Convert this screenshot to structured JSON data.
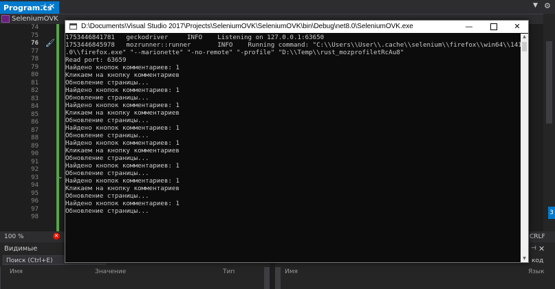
{
  "vs": {
    "doc_tab": "Program.cs",
    "doc_tab_pin": "⊣",
    "doc_tab_close": "✕",
    "nav_combo": "SeleniumOVK",
    "line_numbers": [
      "74",
      "75",
      "76",
      "77",
      "78",
      "79",
      "80",
      "81",
      "82",
      "83",
      "84",
      "85",
      "86",
      "87",
      "88",
      "89",
      "90",
      "91",
      "92",
      "93",
      "94",
      "95",
      "96",
      "97",
      "98"
    ],
    "current_line": "76",
    "zoom": "100 %",
    "error_glyph": "✕",
    "line_ending": "CRLF",
    "right_marker": "3",
    "locals_panel": {
      "title": "Видимые",
      "search_placeholder": "Поиск (Ctrl+E)",
      "col_name": "Имя",
      "col_value": "Значение",
      "col_type": "Тип"
    },
    "right_panel": {
      "pin": "⊣",
      "close": "✕",
      "suffix_text": "код",
      "col_name": "Имя",
      "col_lang": "Язык"
    }
  },
  "console": {
    "title": "D:\\Documents\\Visual Studio 2017\\Projects\\SeleniumOVK\\SeleniumOVK\\bin\\Debug\\net8.0\\SeleniumOVK.exe",
    "minimize": "—",
    "close": "✕",
    "lines": [
      "1753446841781   geckodriver     INFO    Listening on 127.0.0.1:63650",
      "1753446845978   mozrunner::runner       INFO    Running command: \"C:\\\\Users\\\\User\\\\.cache\\\\selenium\\\\firefox\\\\win64\\\\141",
      ".0\\\\firefox.exe\" \"--marionette\" \"-no-remote\" \"-profile\" \"D:\\\\Temp\\\\rust_mozprofiletRcAu8\"",
      "Read port: 63659",
      "Найдено кнопок комментариев: 1",
      "Кликаем на кнопку комментариев",
      "Обновление страницы...",
      "Найдено кнопок комментариев: 1",
      "Обновление страницы...",
      "Найдено кнопок комментариев: 1",
      "Кликаем на кнопку комментариев",
      "Обновление страницы...",
      "Найдено кнопок комментариев: 1",
      "Обновление страницы...",
      "Найдено кнопок комментариев: 1",
      "Кликаем на кнопку комментариев",
      "Обновление страницы...",
      "Найдено кнопок комментариев: 1",
      "Обновление страницы...",
      "Найдено кнопок комментариев: 1",
      "Кликаем на кнопку комментариев",
      "Обновление страницы...",
      "Найдено кнопок комментариев: 1",
      "Обновление страницы..."
    ]
  }
}
